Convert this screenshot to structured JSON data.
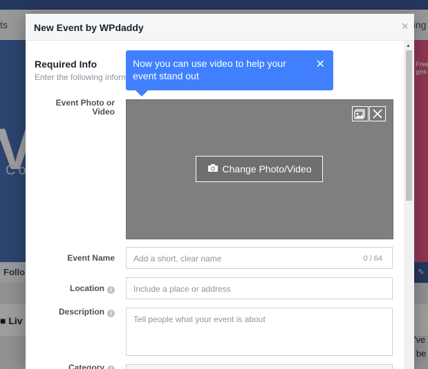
{
  "background": {
    "nav_left": "ts",
    "nav_right": "tting",
    "cover_letter": "V",
    "cover_sub": "Co",
    "promo_text": "Free\ngns fo",
    "follow_label": "Follo",
    "live_label": "Liv",
    "row_right_1": "'ve",
    "row_right_2": "be"
  },
  "dialog": {
    "title": "New Event by WPdaddy",
    "close_glyph": "×",
    "section_title": "Required Info",
    "section_subtitle": "Enter the following inform",
    "tooltip": {
      "text": "Now you can use video to help your event stand out",
      "close_glyph": "✕"
    },
    "photo": {
      "label": "Event Photo or Video",
      "change_label": "Change Photo/Video"
    },
    "event_name": {
      "label": "Event Name",
      "placeholder": "Add a short, clear name",
      "counter": "0 / 64"
    },
    "location": {
      "label": "Location",
      "placeholder": "Include a place or address"
    },
    "description": {
      "label": "Description",
      "placeholder": "Tell people what your event is about"
    },
    "category": {
      "label": "Category"
    }
  },
  "icons": {
    "info": "i",
    "camera": "camera-icon",
    "photo": "photo-icon",
    "remove": "close-icon"
  },
  "colors": {
    "tooltip": "#4080ff",
    "photo_area": "#7f7f7f",
    "header_bg": "#f5f6f7"
  }
}
